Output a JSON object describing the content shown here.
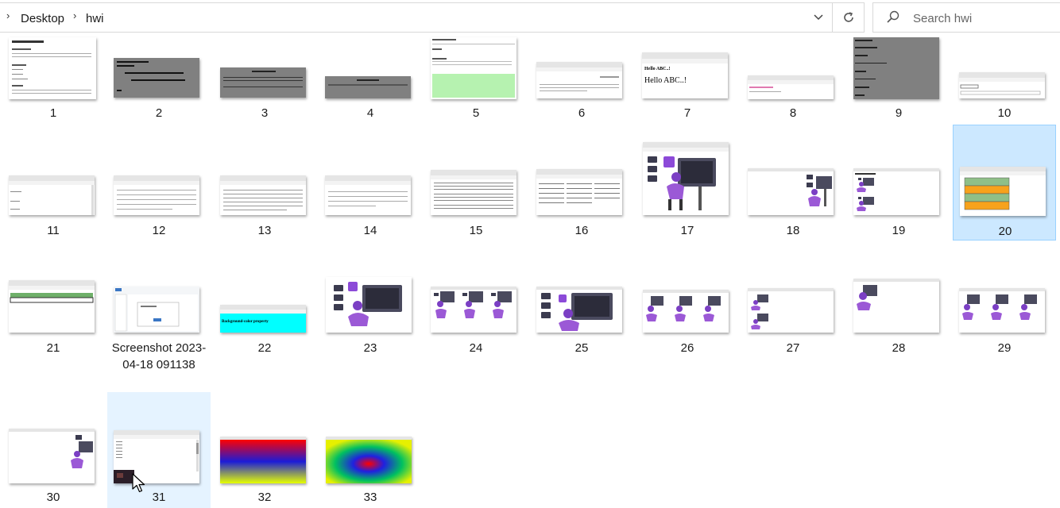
{
  "breadcrumb": {
    "items": [
      "Desktop",
      "hwi"
    ]
  },
  "search": {
    "placeholder": "Search hwi"
  },
  "colors": {
    "selection": "#cce8ff",
    "hover": "#e5f3ff"
  },
  "files": [
    {
      "name": "1"
    },
    {
      "name": "2"
    },
    {
      "name": "3"
    },
    {
      "name": "4"
    },
    {
      "name": "5"
    },
    {
      "name": "6"
    },
    {
      "name": "7"
    },
    {
      "name": "8"
    },
    {
      "name": "9"
    },
    {
      "name": "10"
    },
    {
      "name": "11"
    },
    {
      "name": "12"
    },
    {
      "name": "13"
    },
    {
      "name": "14"
    },
    {
      "name": "15"
    },
    {
      "name": "16"
    },
    {
      "name": "17"
    },
    {
      "name": "18"
    },
    {
      "name": "19"
    },
    {
      "name": "20"
    },
    {
      "name": "21"
    },
    {
      "name": "Screenshot 2023-04-18 091138"
    },
    {
      "name": "22"
    },
    {
      "name": "23"
    },
    {
      "name": "24"
    },
    {
      "name": "25"
    },
    {
      "name": "26"
    },
    {
      "name": "27"
    },
    {
      "name": "28"
    },
    {
      "name": "29"
    },
    {
      "name": "30"
    },
    {
      "name": "31"
    },
    {
      "name": "32"
    },
    {
      "name": "33"
    }
  ],
  "thumb_text": {
    "hello_small": "Hello ABC..!",
    "hello_big": "Hello ABC..!",
    "bg_property": "Background-color property"
  },
  "selected_file": "20",
  "hovered_file": "31"
}
